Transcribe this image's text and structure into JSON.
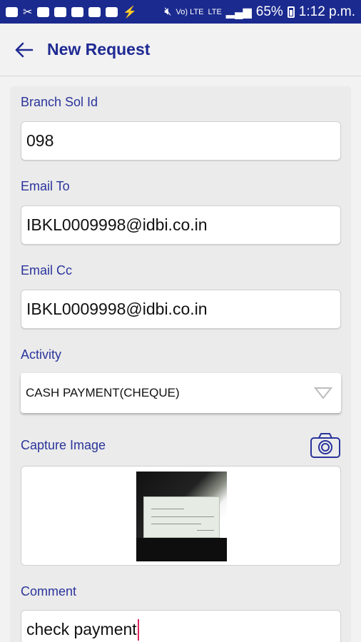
{
  "status_bar": {
    "battery": "65%",
    "time": "1:12 p.m.",
    "network_1": "Vo)\nLTE",
    "network_2": "LTE"
  },
  "header": {
    "title": "New Request"
  },
  "form": {
    "branch_sol_id": {
      "label": "Branch Sol Id",
      "value": "098"
    },
    "email_to": {
      "label": "Email To",
      "value": "IBKL0009998@idbi.co.in"
    },
    "email_cc": {
      "label": "Email Cc",
      "value": "IBKL0009998@idbi.co.in"
    },
    "activity": {
      "label": "Activity",
      "value": "CASH PAYMENT(CHEQUE)"
    },
    "capture_image": {
      "label": "Capture Image"
    },
    "comment": {
      "label": "Comment",
      "value": "check payment"
    }
  },
  "colors": {
    "status_bar": "#1b2a8f",
    "title": "#1f2a93",
    "label": "#2a349b",
    "cursor": "#e0245e"
  }
}
